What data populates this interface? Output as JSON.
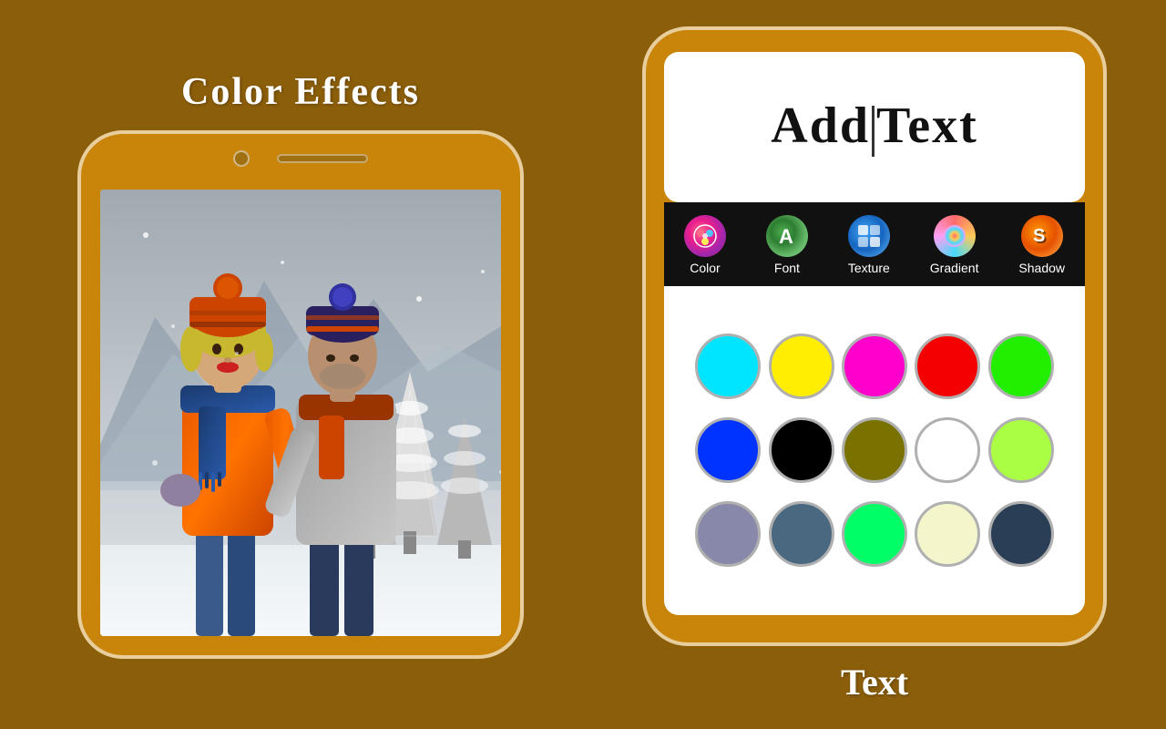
{
  "leftTitle": "Color Effects",
  "rightBottomLabel": "Text",
  "addTextInput": {
    "part1": "Add",
    "part2": "Text"
  },
  "toolbar": {
    "tabs": [
      {
        "id": "color",
        "label": "Color",
        "iconClass": "icon-color",
        "iconText": "🎨",
        "active": true
      },
      {
        "id": "font",
        "label": "Font",
        "iconClass": "icon-font",
        "iconText": "Ⓐ",
        "active": false
      },
      {
        "id": "texture",
        "label": "Texture",
        "iconClass": "icon-texture",
        "iconText": "⊞",
        "active": false
      },
      {
        "id": "gradient",
        "label": "Gradient",
        "iconClass": "icon-gradient",
        "iconText": "◐",
        "active": false
      },
      {
        "id": "shadow",
        "label": "Shadow",
        "iconClass": "icon-shadow",
        "iconText": "S",
        "active": false
      }
    ]
  },
  "colorPalette": {
    "rows": [
      [
        {
          "id": "cyan",
          "color": "#00e5ff",
          "border": "#b0b0b0"
        },
        {
          "id": "yellow",
          "color": "#ffee00",
          "border": "#b0b0b0"
        },
        {
          "id": "magenta",
          "color": "#ff00cc",
          "border": "#b0b0b0"
        },
        {
          "id": "red",
          "color": "#f50000",
          "border": "#b0b0b0"
        },
        {
          "id": "green",
          "color": "#22ee00",
          "border": "#b0b0b0"
        }
      ],
      [
        {
          "id": "blue",
          "color": "#0033ff",
          "border": "#b0b0b0"
        },
        {
          "id": "black",
          "color": "#000000",
          "border": "#b0b0b0"
        },
        {
          "id": "olive",
          "color": "#7a7200",
          "border": "#b0b0b0"
        },
        {
          "id": "white",
          "color": "#ffffff",
          "border": "#b0b0b0"
        },
        {
          "id": "lime",
          "color": "#aaff44",
          "border": "#b0b0b0"
        }
      ],
      [
        {
          "id": "lavender",
          "color": "#8888aa",
          "border": "#b0b0b0"
        },
        {
          "id": "steel",
          "color": "#4a6880",
          "border": "#b0b0b0"
        },
        {
          "id": "neon-green",
          "color": "#00ff66",
          "border": "#b0b0b0"
        },
        {
          "id": "cream",
          "color": "#f5f5cc",
          "border": "#b0b0b0"
        },
        {
          "id": "dark-slate",
          "color": "#2a3f55",
          "border": "#b0b0b0"
        }
      ]
    ]
  }
}
